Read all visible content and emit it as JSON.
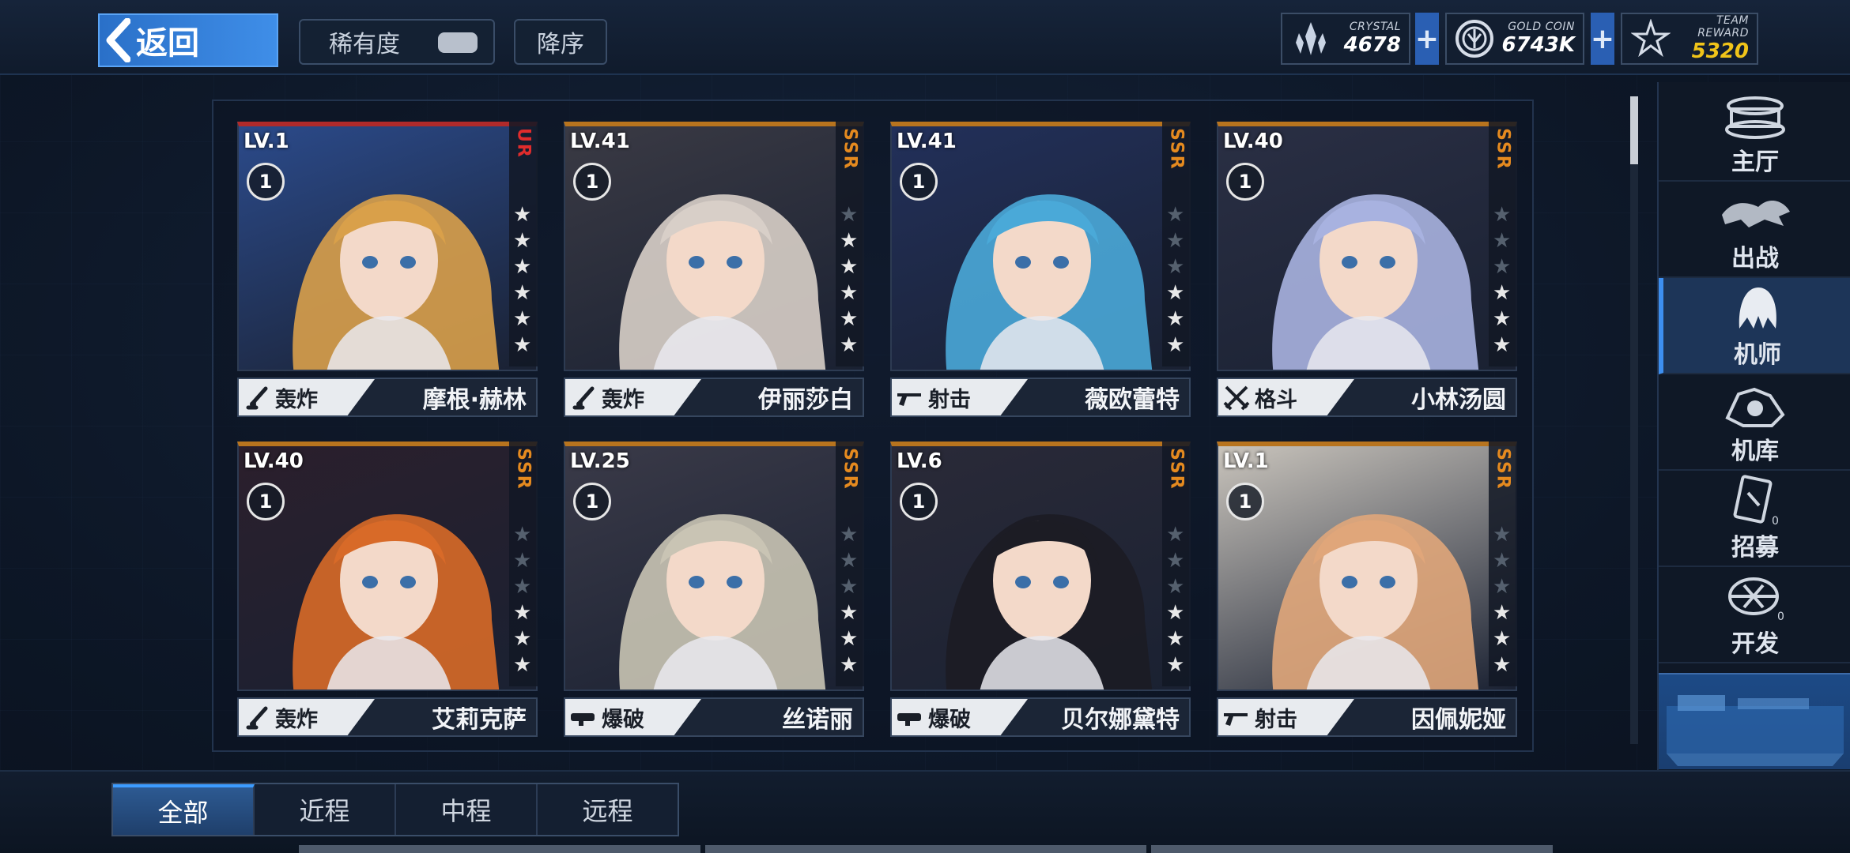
{
  "header": {
    "back_label": "返回",
    "sort_rarity_label": "稀有度",
    "sort_order_label": "降序",
    "resources": [
      {
        "caption": "CRYSTAL",
        "value": "4678",
        "icon": "crystal-icon"
      },
      {
        "caption": "GOLD COIN",
        "value": "6743K",
        "icon": "gold-coin-icon"
      },
      {
        "caption": "TEAM REWARD",
        "value": "5320",
        "icon": "team-reward-icon",
        "color": "#f0c419"
      }
    ]
  },
  "cards": [
    {
      "level": "LV.1",
      "rank": "1",
      "rarity": "UR",
      "stars_total": 6,
      "stars_lit": 6,
      "role": "轰炸",
      "role_icon": "mortar-icon",
      "name": "摩根·赫林",
      "hair": "#d9a04a",
      "bg": "#2b4a8a"
    },
    {
      "level": "LV.41",
      "rank": "1",
      "rarity": "SSR",
      "stars_total": 6,
      "stars_lit": 5,
      "role": "轰炸",
      "role_icon": "mortar-icon",
      "name": "伊丽莎白",
      "hair": "#d8cfc8",
      "bg": "#3a3a44"
    },
    {
      "level": "LV.41",
      "rank": "1",
      "rarity": "SSR",
      "stars_total": 6,
      "stars_lit": 3,
      "role": "射击",
      "role_icon": "rifle-icon",
      "name": "薇欧蕾特",
      "hair": "#4aa9d8",
      "bg": "#22305a"
    },
    {
      "level": "LV.40",
      "rank": "1",
      "rarity": "SSR",
      "stars_total": 6,
      "stars_lit": 3,
      "role": "格斗",
      "role_icon": "crossed-swords-icon",
      "name": "小林汤圆",
      "hair": "#a8b2e0",
      "bg": "#2a2f44"
    },
    {
      "level": "LV.40",
      "rank": "1",
      "rarity": "SSR",
      "stars_total": 6,
      "stars_lit": 3,
      "role": "轰炸",
      "role_icon": "mortar-icon",
      "name": "艾莉克萨",
      "hair": "#d86a28",
      "bg": "#2b1f2c"
    },
    {
      "level": "LV.25",
      "rank": "1",
      "rarity": "SSR",
      "stars_total": 6,
      "stars_lit": 3,
      "role": "爆破",
      "role_icon": "launcher-icon",
      "name": "丝诺丽",
      "hair": "#c9c4b4",
      "bg": "#3a3a48"
    },
    {
      "level": "LV.6",
      "rank": "1",
      "rarity": "SSR",
      "stars_total": 6,
      "stars_lit": 3,
      "role": "爆破",
      "role_icon": "launcher-icon",
      "name": "贝尔娜黛特",
      "hair": "#1c1c24",
      "bg": "#2a2a38"
    },
    {
      "level": "LV.1",
      "rank": "1",
      "rarity": "SSR",
      "stars_total": 6,
      "stars_lit": 3,
      "role": "射击",
      "role_icon": "rifle-icon",
      "name": "因佩妮娅",
      "hair": "#e0a67a",
      "bg": "#c9c4bc"
    }
  ],
  "nav": [
    {
      "label": "主厅",
      "icon": "lobby-icon"
    },
    {
      "label": "出战",
      "icon": "battle-icon"
    },
    {
      "label": "机师",
      "icon": "pilot-icon",
      "active": true
    },
    {
      "label": "机库",
      "icon": "hangar-icon"
    },
    {
      "label": "招募",
      "icon": "recruit-icon"
    },
    {
      "label": "开发",
      "icon": "develop-icon"
    }
  ],
  "tabs": [
    {
      "label": "全部",
      "active": true
    },
    {
      "label": "近程"
    },
    {
      "label": "中程"
    },
    {
      "label": "远程"
    }
  ],
  "colors": {
    "accent": "#3d8ff0",
    "ssr": "#e58a1f",
    "ur": "#e02c2c"
  }
}
